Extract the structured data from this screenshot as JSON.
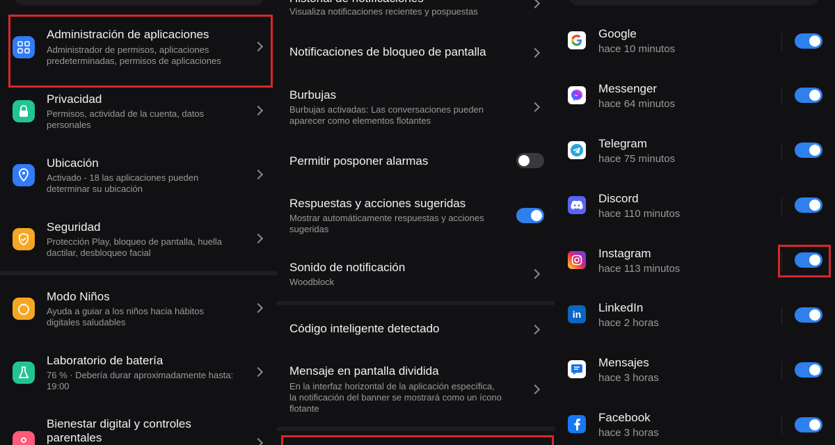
{
  "settings": {
    "items": [
      {
        "title": "Administración de aplicaciones",
        "sub1": "Administrador de permisos, aplicaciones",
        "sub2": "predeterminadas, permisos de aplicaciones"
      },
      {
        "title": "Privacidad",
        "sub1": "Permisos, actividad de la cuenta, datos",
        "sub2": "personales"
      },
      {
        "title": "Ubicación",
        "sub1": "Activado - 18 las aplicaciones pueden",
        "sub2": "determinar su ubicación"
      },
      {
        "title": "Seguridad",
        "sub1": "Protección Play, bloqueo de pantalla, huella",
        "sub2": "dactilar, desbloqueo facial"
      },
      {
        "title": "Modo Niños",
        "sub1": "Ayuda a guiar a los niños hacia hábitos",
        "sub2": "digitales saludables"
      },
      {
        "title": "Laboratorio de batería",
        "sub1": "76 % · Debería durar aproximadamente hasta:",
        "sub2": "19:00"
      },
      {
        "title": "Bienestar digital y controles",
        "title2": "parentales"
      }
    ],
    "colors": {
      "apps": "#2f7cf6",
      "privacy": "#22c493",
      "location": "#2f7cf6",
      "security": "#f5a623",
      "kids": "#f5a623",
      "battery": "#22c493",
      "wellbeing": "#ff5a7a"
    }
  },
  "notifications": {
    "top_partial": {
      "title": "Historial de notificaciones",
      "sub": "Visualiza notificaciones recientes y pospuestas"
    },
    "items": [
      {
        "title": "Notificaciones de bloqueo de pantalla"
      },
      {
        "title": "Burbujas",
        "sub1": "Burbujas activadas: Las conversaciones pueden",
        "sub2": "aparecer como elementos flotantes"
      },
      {
        "title": "Permitir posponer alarmas",
        "toggle": false
      },
      {
        "title": "Respuestas y acciones sugeridas",
        "sub1": "Mostrar automáticamente respuestas y acciones",
        "sub2": "sugeridas",
        "toggle": true
      },
      {
        "title": "Sonido de notificación",
        "sub1": "Woodblock"
      },
      {
        "title": "Código inteligente detectado"
      },
      {
        "title": "Mensaje en pantalla dividida",
        "sub1": "En la interfaz horizontal de la aplicación específica,",
        "sub2": "la notificación del banner se mostrará como un ícono",
        "sub3": "flotante"
      }
    ]
  },
  "apps": {
    "items": [
      {
        "name": "Google",
        "time": "hace 10 minutos",
        "icon": "google-icon",
        "on": true
      },
      {
        "name": "Messenger",
        "time": "hace 64 minutos",
        "icon": "messenger-icon",
        "on": true
      },
      {
        "name": "Telegram",
        "time": "hace 75 minutos",
        "icon": "telegram-icon",
        "on": true
      },
      {
        "name": "Discord",
        "time": "hace 110 minutos",
        "icon": "discord-icon",
        "on": true
      },
      {
        "name": "Instagram",
        "time": "hace 113 minutos",
        "icon": "instagram-icon",
        "on": true
      },
      {
        "name": "LinkedIn",
        "time": "hace 2 horas",
        "icon": "linkedin-icon",
        "on": true
      },
      {
        "name": "Mensajes",
        "time": "hace 3 horas",
        "icon": "messages-icon",
        "on": true
      },
      {
        "name": "Facebook",
        "time": "hace 3 horas",
        "icon": "facebook-icon",
        "on": true
      }
    ],
    "accent": "#2f80ed"
  }
}
